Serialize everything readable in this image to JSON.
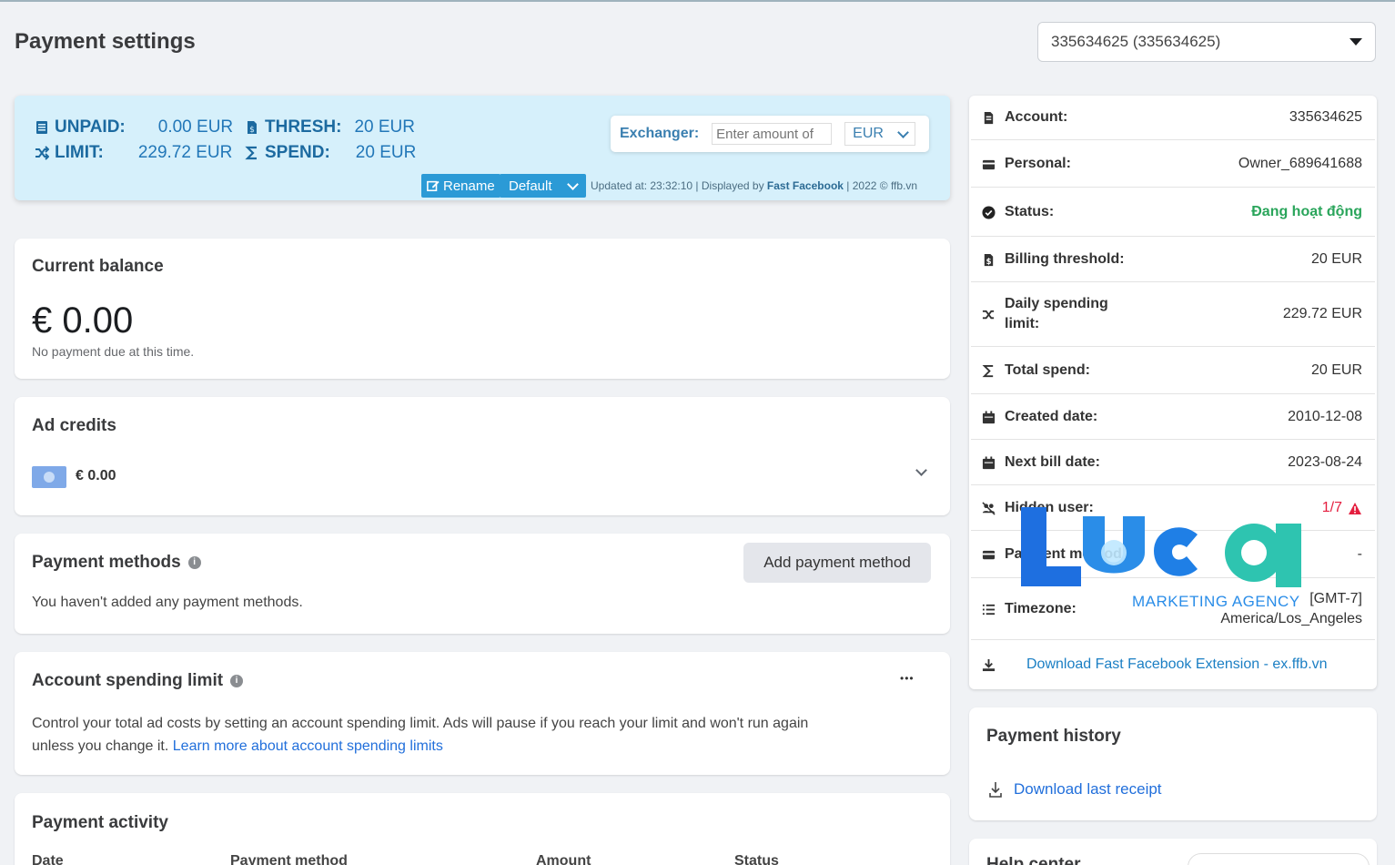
{
  "page": {
    "title": "Payment settings"
  },
  "account_selector": {
    "value": "335634625 (335634625)"
  },
  "banner": {
    "unpaid_label": "UNPAID:",
    "unpaid_value": "0.00 EUR",
    "thresh_label": "THRESH:",
    "thresh_value": "20 EUR",
    "limit_label": "LIMIT:",
    "limit_value": "229.72 EUR",
    "spend_label": "SPEND:",
    "spend_value": "20 EUR",
    "exchanger_label": "Exchanger:",
    "exchanger_placeholder": "Enter amount of",
    "currency": "EUR",
    "rename_label": "Rename",
    "default_label": "Default",
    "updated_text": "Updated at: 23:32:10 | Displayed by ",
    "brand": "Fast Facebook",
    "updated_suffix": " | 2022 © ffb.vn"
  },
  "current_balance": {
    "title": "Current balance",
    "amount": "€ 0.00",
    "note": "No payment due at this time."
  },
  "ad_credits": {
    "title": "Ad credits",
    "amount": "€ 0.00"
  },
  "payment_methods": {
    "title": "Payment methods",
    "add_label": "Add payment method",
    "empty_text": "You haven't added any payment methods."
  },
  "spending_limit": {
    "title": "Account spending limit",
    "more": "•••",
    "text_line1": "Control your total ad costs by setting an account spending limit. Ads will pause if you reach your limit and won't run again",
    "text_line2": "unless you change it. ",
    "link": "Learn more about account spending limits"
  },
  "payment_activity": {
    "title": "Payment activity",
    "columns": [
      "Date",
      "Payment method",
      "Amount",
      "Status"
    ]
  },
  "account_info": {
    "rows": [
      {
        "label": "Account:",
        "value": "335634625",
        "icon": "document-icon"
      },
      {
        "label": "Personal:",
        "value": "Owner_689641688",
        "icon": "id-card-icon"
      },
      {
        "label": "Status:",
        "value": "Đang hoạt động",
        "icon": "check-circle-icon"
      },
      {
        "label": "Billing threshold:",
        "value": "20 EUR",
        "icon": "file-dollar-icon"
      },
      {
        "label": "Daily spending limit:",
        "value": "229.72 EUR",
        "icon": "shuffle-icon"
      },
      {
        "label": "Total spend:",
        "value": "20 EUR",
        "icon": "sigma-icon"
      },
      {
        "label": "Created date:",
        "value": "2010-12-08",
        "icon": "calendar-icon"
      },
      {
        "label": "Next bill date:",
        "value": "2023-08-24",
        "icon": "calendar-icon"
      },
      {
        "label": "Hidden user:",
        "value": "1/7",
        "icon": "users-slash-icon"
      },
      {
        "label": "Payment method:",
        "value": "-",
        "icon": "credit-card-icon"
      },
      {
        "label": "Timezone:",
        "value_line1": "[GMT-7]",
        "value_line2": "America/Los_Angeles",
        "icon": "list-icon"
      }
    ],
    "download_label": "Download Fast Facebook Extension - ex.ffb.vn",
    "status_color": "#2aa55b",
    "warning_color": "#e41e3f"
  },
  "payment_history": {
    "title": "Payment history",
    "download_label": "Download last receipt"
  },
  "help_center": {
    "title": "Help center"
  },
  "watermark": {
    "text": "Luca",
    "subtitle": "MARKETING AGENCY"
  }
}
